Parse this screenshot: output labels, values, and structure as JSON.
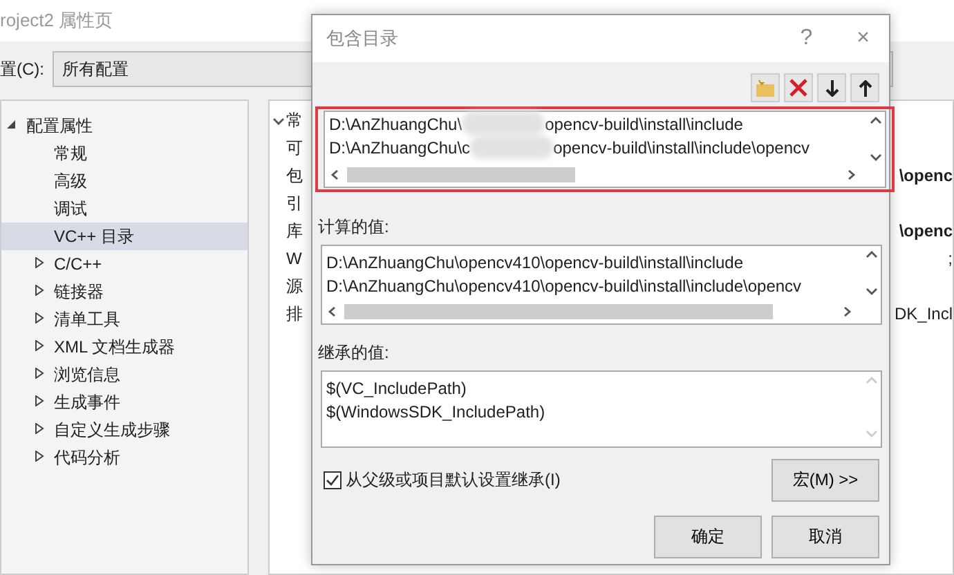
{
  "window": {
    "title": "roject2 属性页"
  },
  "configuration": {
    "label": "置(C):",
    "value": "所有配置"
  },
  "tree": [
    {
      "label": "配置属性",
      "expanded": true,
      "selected": false,
      "children": [
        {
          "label": "常规",
          "selected": false
        },
        {
          "label": "高级",
          "selected": false
        },
        {
          "label": "调试",
          "selected": false
        },
        {
          "label": "VC++ 目录",
          "selected": true
        },
        {
          "label": "C/C++",
          "expanded": false,
          "selected": false
        },
        {
          "label": "链接器",
          "expanded": false,
          "selected": false
        },
        {
          "label": "清单工具",
          "expanded": false,
          "selected": false
        },
        {
          "label": "XML 文档生成器",
          "expanded": false,
          "selected": false
        },
        {
          "label": "浏览信息",
          "expanded": false,
          "selected": false
        },
        {
          "label": "生成事件",
          "expanded": false,
          "selected": false
        },
        {
          "label": "自定义生成步骤",
          "expanded": false,
          "selected": false
        },
        {
          "label": "代码分析",
          "expanded": false,
          "selected": false
        }
      ]
    }
  ],
  "property_grid": {
    "group": {
      "label": "常",
      "expanded": true
    },
    "rows": [
      {
        "name": "可"
      },
      {
        "name": "包",
        "value": "\\openc",
        "bold": true
      },
      {
        "name": "引"
      },
      {
        "name": "库",
        "value": "\\openc",
        "bold": true
      },
      {
        "name": "W",
        "value": ";",
        "bold": false
      },
      {
        "name": "源"
      },
      {
        "name": "排",
        "value": "DK_Incl",
        "bold": false
      }
    ]
  },
  "dialog": {
    "title": "包含目录",
    "help": "?",
    "close": "×",
    "toolbar": [
      {
        "kind": "new-folder"
      },
      {
        "kind": "delete"
      },
      {
        "kind": "down"
      },
      {
        "kind": "up"
      }
    ],
    "entries": [
      {
        "before": "D:\\AnZhuangChu\\",
        "after": "opencv-build\\install\\include"
      },
      {
        "before": "D:\\AnZhuangChu\\c",
        "after": "opencv-build\\install\\include\\opencv"
      }
    ],
    "evaluated": {
      "label": "计算的值:",
      "lines": [
        "D:\\AnZhuangChu\\opencv410\\opencv-build\\install\\include",
        "D:\\AnZhuangChu\\opencv410\\opencv-build\\install\\include\\opencv"
      ]
    },
    "inherited": {
      "label": "继承的值:",
      "lines": [
        "$(VC_IncludePath)",
        "$(WindowsSDK_IncludePath)"
      ]
    },
    "inherit_checkbox": {
      "label": "从父级或项目默认设置继承(I)",
      "checked": true
    },
    "macros_button": "宏(M) >>",
    "buttons": [
      "确定",
      "取消"
    ]
  }
}
